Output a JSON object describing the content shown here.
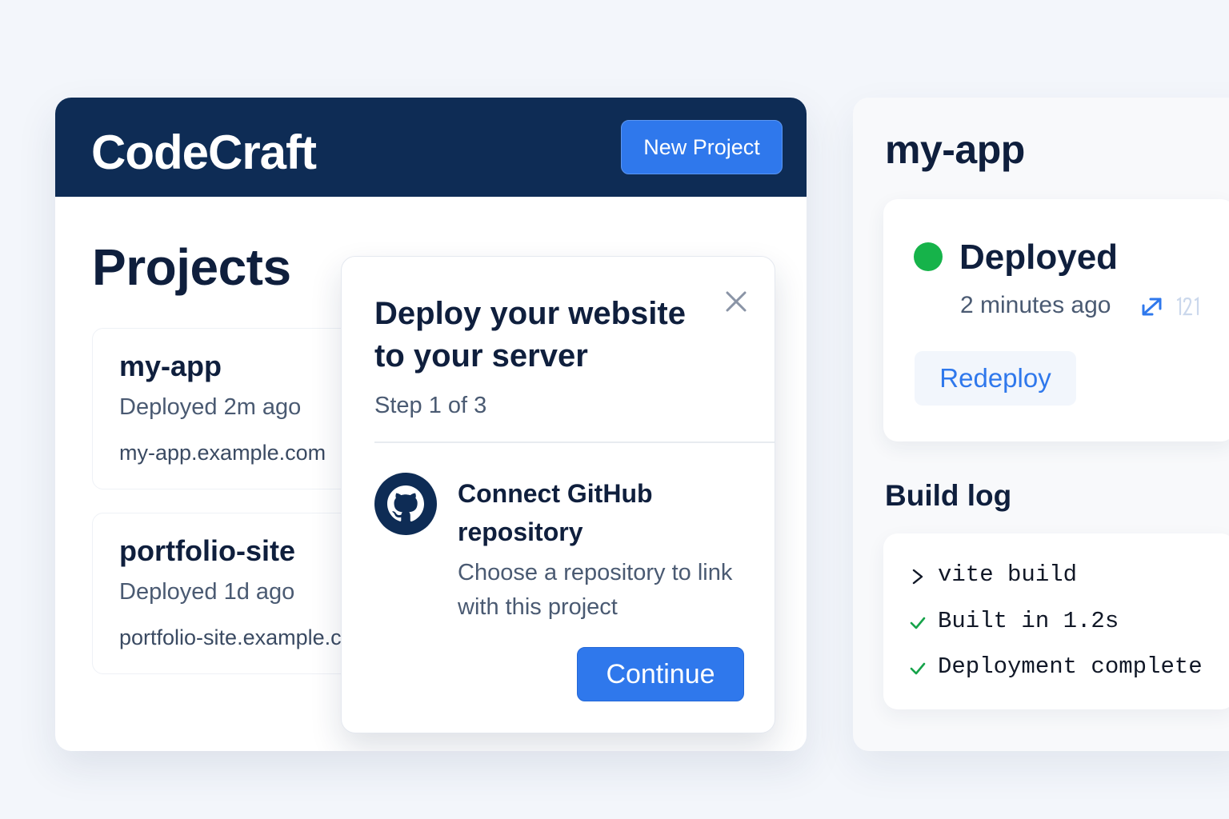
{
  "header": {
    "brand": "CodeCraft",
    "new_project_label": "New Project"
  },
  "projects": {
    "title": "Projects",
    "items": [
      {
        "name": "my-app",
        "status": "Deployed 2m ago",
        "url": "my-app.example.com"
      },
      {
        "name": "portfolio-site",
        "status": "Deployed 1d ago",
        "url": "portfolio-site.example.com"
      }
    ]
  },
  "modal": {
    "title": "Deploy your website to your server",
    "step": "Step 1 of 3",
    "connect_title": "Connect GitHub repository",
    "connect_desc": "Choose a repository to link with this project",
    "continue_label": "Continue",
    "icons": {
      "close": "close-icon",
      "provider": "github-icon"
    }
  },
  "detail": {
    "title": "my-app",
    "status": "Deployed",
    "time": "2 minutes ago",
    "redeploy_label": "Redeploy",
    "status_color": "#16b34a",
    "icons": {
      "open": "external-link-icon",
      "aux": "faded-counter-icon"
    }
  },
  "build_log": {
    "title": "Build log",
    "lines": [
      {
        "icon": "prompt-icon",
        "text": "vite build"
      },
      {
        "icon": "check-icon",
        "text": "Built in 1.2s"
      },
      {
        "icon": "check-icon",
        "text": "Deployment complete"
      }
    ]
  },
  "colors": {
    "header_bg": "#0e2c55",
    "accent": "#2f78ec",
    "success": "#16b34a",
    "text_dark": "#0f1f3d",
    "text_muted": "#4a5a72"
  }
}
